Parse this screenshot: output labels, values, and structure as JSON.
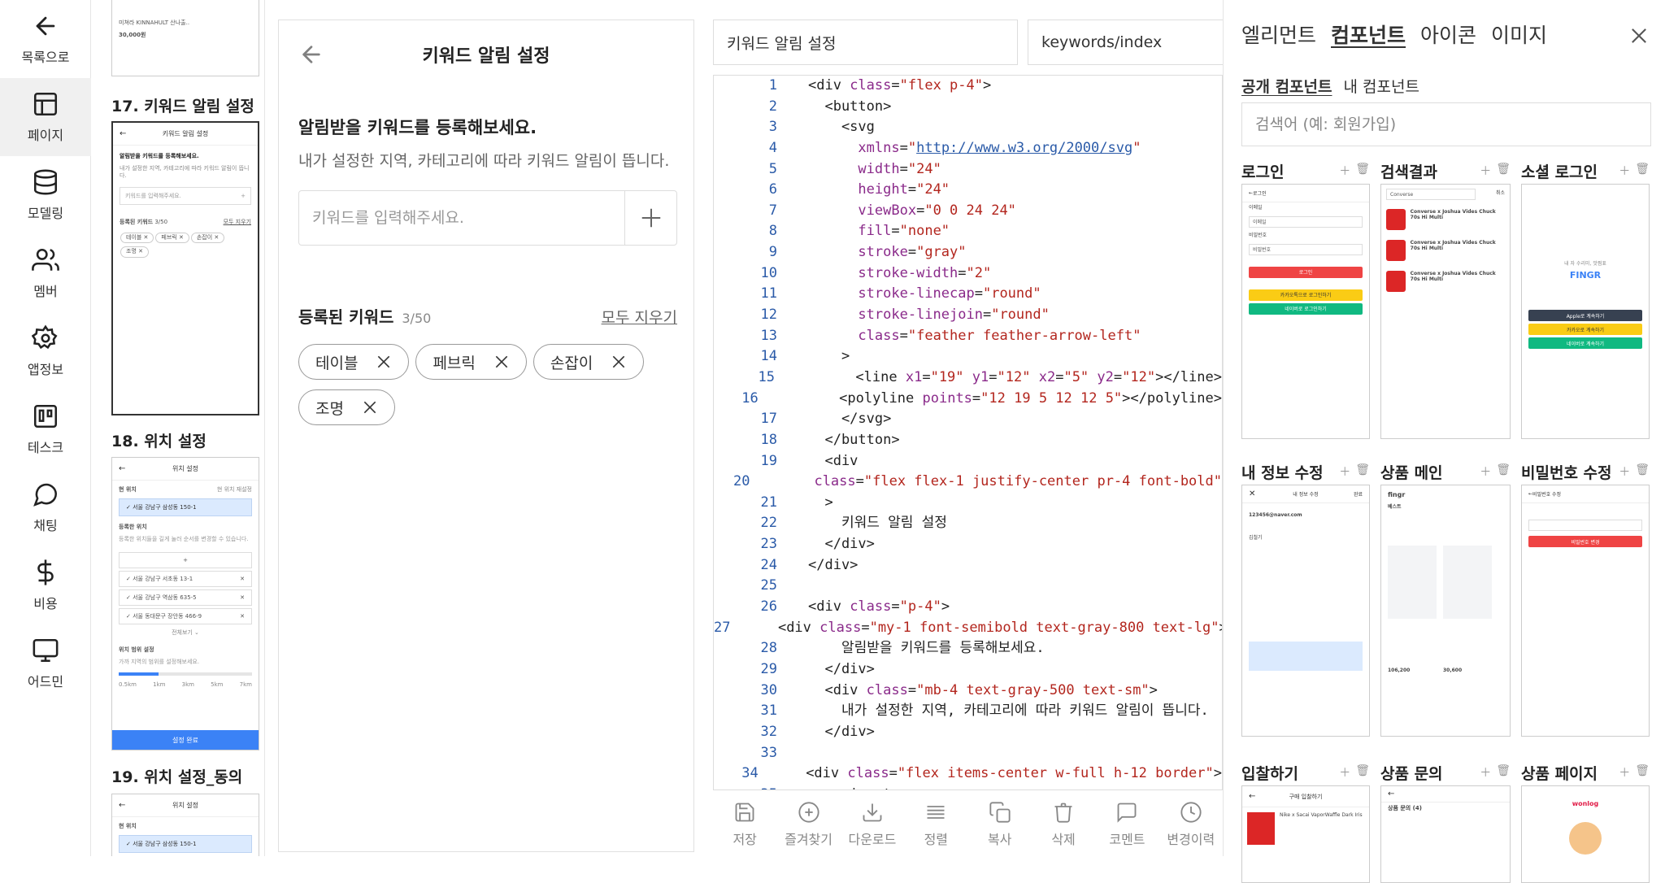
{
  "nav": {
    "items": [
      {
        "label": "목록으로",
        "icon": "arrow-left-icon"
      },
      {
        "label": "페이지",
        "icon": "layout-icon",
        "active": true
      },
      {
        "label": "모델링",
        "icon": "database-icon"
      },
      {
        "label": "멤버",
        "icon": "users-icon"
      },
      {
        "label": "앱정보",
        "icon": "settings-icon"
      },
      {
        "label": "테스크",
        "icon": "trello-icon"
      },
      {
        "label": "채팅",
        "icon": "message-circle-icon"
      },
      {
        "label": "비용",
        "icon": "dollar-sign-icon"
      },
      {
        "label": "어드민",
        "icon": "monitor-icon"
      }
    ]
  },
  "pages": {
    "top_thumb": {
      "item1": "미쳐라 KINNAHULT 산나출..",
      "price": "30,000원"
    },
    "p17": {
      "title": "17. 키워드 알림 설정",
      "header": "키워드 알림 설정",
      "h": "알림받을 키워드를 등록해보세요.",
      "sub": "내가 설정한 지역, 카테고리에 따라 키워드 알림이 뜹니다.",
      "input": "키워드를 입력해주세요.",
      "reg": "등록된 키워드",
      "count": "3/50",
      "clear": "모두 지우기",
      "chips": [
        "테이블",
        "페브릭",
        "손잡이",
        "조명"
      ]
    },
    "p18": {
      "title": "18. 위치 설정",
      "header": "위치 설정",
      "cur": "현 위치",
      "cur_btn": "현 위치 재설정",
      "cur_val": "서울 강남구 삼성동 150-1",
      "reg": "등록한 위치",
      "reg_sub": "등록한 위치들을 길게 눌러 순서를 변경할 수 있습니다.",
      "rows": [
        "서울 강남구 서초동 13-1",
        "서울 강남구 역삼동 635-5",
        "서울 동대문구 장안동 466-9"
      ],
      "more": "전체보기",
      "range": "위치 범위 설정",
      "range_sub": "가까 지역의 범위를 설정해보세요.",
      "ticks": [
        "0.5km",
        "1km",
        "3km",
        "5km",
        "7km"
      ],
      "done": "설정 완료"
    },
    "p19": {
      "title": "19. 위치 설정_동의",
      "header": "위치 설정",
      "cur": "현 위치",
      "cur_val": "서울 강남구 삼성동 150-1"
    }
  },
  "preview": {
    "title": "키워드 알림 설정",
    "heading": "알림받을 키워드를 등록해보세요.",
    "subtext": "내가 설정한 지역, 카테고리에 따라 키워드 알림이 뜹니다.",
    "input_placeholder": "키워드를 입력해주세요.",
    "registered_label": "등록된 키워드",
    "registered_count": "3/50",
    "clear_all": "모두 지우기",
    "chips": [
      "테이블",
      "페브릭",
      "손잡이",
      "조명"
    ]
  },
  "editor": {
    "page_name": "키워드 알림 설정",
    "route": "keywords/index",
    "lines": [
      "<div class=\"flex p-4\">",
      "  <button>",
      "    <svg",
      "      xmlns=\"http://www.w3.org/2000/svg\"",
      "      width=\"24\"",
      "      height=\"24\"",
      "      viewBox=\"0 0 24 24\"",
      "      fill=\"none\"",
      "      stroke=\"gray\"",
      "      stroke-width=\"2\"",
      "      stroke-linecap=\"round\"",
      "      stroke-linejoin=\"round\"",
      "      class=\"feather feather-arrow-left\"",
      "    >",
      "      <line x1=\"19\" y1=\"12\" x2=\"5\" y2=\"12\"></line>",
      "      <polyline points=\"12 19 5 12 12 5\"></polyline>",
      "    </svg>",
      "  </button>",
      "  <div",
      "    class=\"flex flex-1 justify-center pr-4 font-bold\"",
      "  >",
      "    키워드 알림 설정",
      "  </div>",
      "</div>",
      "",
      "<div class=\"p-4\">",
      "  <div class=\"my-1 font-semibold text-gray-800 text-lg\">",
      "    알림받을 키워드를 등록해보세요.",
      "  </div>",
      "  <div class=\"mb-4 text-gray-500 text-sm\">",
      "    내가 설정한 지역, 카테고리에 따라 키워드 알림이 뜹니다.",
      "  </div>",
      "",
      "  <div class=\"flex items-center w-full h-12 border\">",
      "    <input"
    ],
    "tools": [
      {
        "label": "저장",
        "icon": "save-icon"
      },
      {
        "label": "즐겨찾기",
        "icon": "plus-circle-icon"
      },
      {
        "label": "다운로드",
        "icon": "download-icon"
      },
      {
        "label": "정렬",
        "icon": "align-justify-icon"
      },
      {
        "label": "복사",
        "icon": "copy-icon"
      },
      {
        "label": "삭제",
        "icon": "trash-icon"
      },
      {
        "label": "코멘트",
        "icon": "message-square-icon"
      },
      {
        "label": "변경이력",
        "icon": "clock-icon"
      }
    ]
  },
  "panel": {
    "tabs": [
      "엘리먼트",
      "컴포넌트",
      "아이콘",
      "이미지"
    ],
    "active_tab": "컴포넌트",
    "subtabs": [
      "공개 컴포넌트",
      "내 컴포넌트"
    ],
    "search_placeholder": "검색어 (예: 회원가입)",
    "cards": [
      {
        "name": "로그인"
      },
      {
        "name": "검색결과"
      },
      {
        "name": "소셜 로그인"
      },
      {
        "name": "내 정보 수정"
      },
      {
        "name": "상품 메인"
      },
      {
        "name": "비밀번호 수정"
      },
      {
        "name": "입찰하기"
      },
      {
        "name": "상품 문의"
      },
      {
        "name": "상품 페이지"
      }
    ],
    "mini": {
      "login": {
        "header": "로그인",
        "email": "이메일",
        "email_val": "이메일",
        "pw": "비밀번호",
        "pw_val": "비밀번호",
        "btn": "로그인",
        "kakao": "카카오톡으로 로그인하기",
        "naver": "네이버로 로그인하기"
      },
      "search": {
        "query": "Converse",
        "cancel": "취소",
        "item": "Converse x Joshua Vides Chuck 70s Hi Multi"
      },
      "social": {
        "tagline": "내 자 수리미, 맛찜표",
        "brand": "FINGR",
        "apple": "Apple로 계속하기",
        "kakao": "카카오로 계속하기",
        "naver": "네이버로 계속하기"
      },
      "profile": {
        "header": "내 정보 수정",
        "save": "완료",
        "email": "123456@naver.com",
        "name": "김철기"
      },
      "shop": {
        "brand": "fingr",
        "tabs": "베스트",
        "p1": "106,200",
        "p2": "30,600"
      },
      "password": {
        "header": "비밀번호 수정",
        "btn": "비밀번호 변경"
      },
      "bid": {
        "header": "구매 입찰하기",
        "item": "Nike x Sacai VaporWaffle Dark Iris"
      },
      "qna": {
        "header": "상품 문의 (4)"
      },
      "product": {
        "brand": "wonlog"
      }
    }
  },
  "colors": {
    "accent": "#3b82f6",
    "danger": "#ef4444",
    "kakao": "#facc15",
    "naver": "#10b981",
    "apple": "#374151",
    "link": "#2a5aa8"
  }
}
